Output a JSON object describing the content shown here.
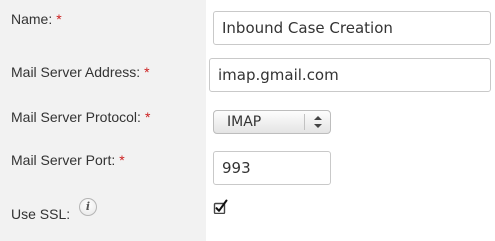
{
  "form": {
    "name": {
      "label": "Name:",
      "required_mark": "*",
      "value": "Inbound Case Creation"
    },
    "mail_server_address": {
      "label": "Mail Server Address:",
      "required_mark": "*",
      "value": "imap.gmail.com"
    },
    "mail_server_protocol": {
      "label": "Mail Server Protocol:",
      "required_mark": "*",
      "selected": "IMAP"
    },
    "mail_server_port": {
      "label": "Mail Server Port:",
      "required_mark": "*",
      "value": "993"
    },
    "use_ssl": {
      "label": "Use SSL:",
      "info_icon": "info-icon",
      "checked": true
    }
  },
  "colors": {
    "label_background": "#f2f2f2",
    "required": "#cc1f1f",
    "text": "#333333"
  }
}
